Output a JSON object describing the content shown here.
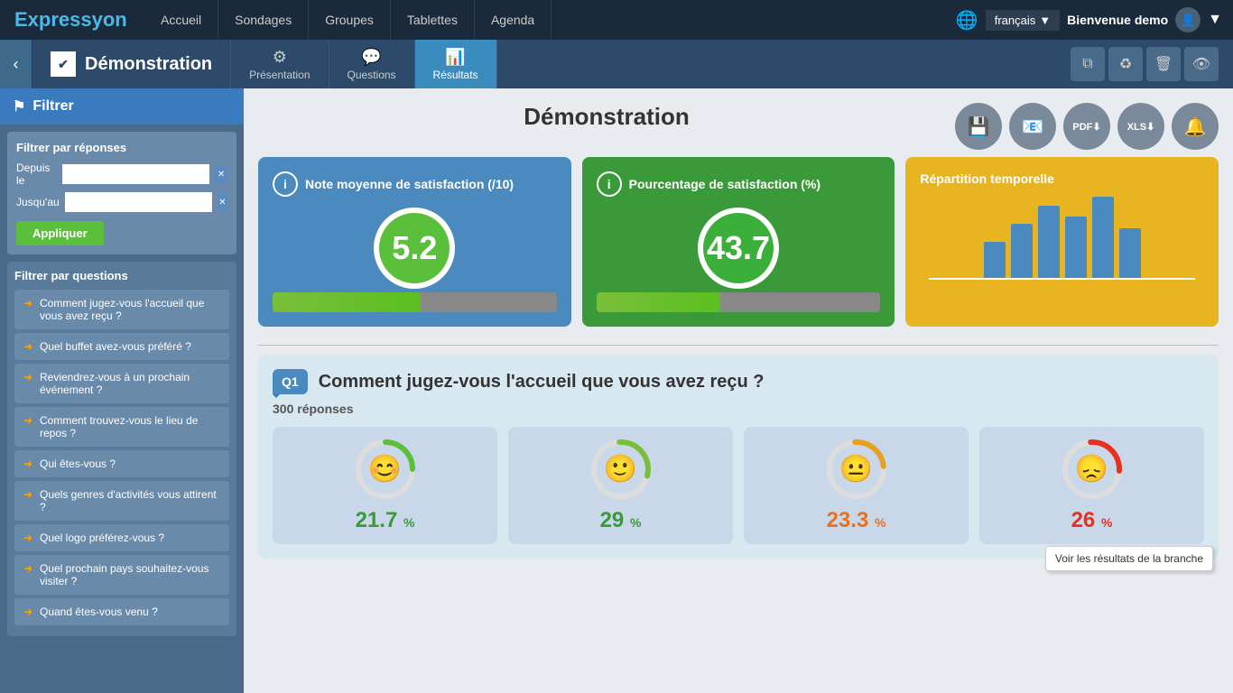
{
  "app": {
    "logo": "Expressyon",
    "nav": {
      "items": [
        {
          "label": "Accueil"
        },
        {
          "label": "Sondages"
        },
        {
          "label": "Groupes"
        },
        {
          "label": "Tablettes"
        },
        {
          "label": "Agenda"
        }
      ]
    },
    "language": "français",
    "welcome": "Bienvenue demo"
  },
  "survey_bar": {
    "back_label": "‹",
    "survey_icon": "✔",
    "survey_title": "Démonstration",
    "tabs": [
      {
        "id": "presentation",
        "icon": "⚙",
        "label": "Présentation"
      },
      {
        "id": "questions",
        "icon": "💬",
        "label": "Questions"
      },
      {
        "id": "resultats",
        "icon": "📊",
        "label": "Résultats",
        "active": true
      }
    ],
    "actions": [
      {
        "icon": "⧉",
        "label": "copy"
      },
      {
        "icon": "♻",
        "label": "recycle"
      },
      {
        "icon": "🗑",
        "label": "delete"
      },
      {
        "icon": "👁",
        "label": "preview"
      }
    ]
  },
  "sidebar": {
    "header": "Filtrer",
    "filter_by_responses": "Filtrer par réponses",
    "depuis_label": "Depuis le",
    "jusquau_label": "Jusqu'au",
    "apply_label": "Appliquer",
    "filter_by_questions": "Filtrer par questions",
    "questions": [
      {
        "text": "Comment jugez-vous l'accueil que vous avez reçu ?"
      },
      {
        "text": "Quel buffet avez-vous préféré ?"
      },
      {
        "text": "Reviendrez-vous à un prochain événement ?"
      },
      {
        "text": "Comment trouvez-vous le lieu de repos ?"
      },
      {
        "text": "Qui êtes-vous ?"
      },
      {
        "text": "Quels genres d'activités vous attirent ?"
      },
      {
        "text": "Quel logo préférez-vous ?"
      },
      {
        "text": "Quel prochain pays souhaitez-vous visiter ?"
      },
      {
        "text": "Quand êtes-vous venu ?"
      }
    ]
  },
  "results": {
    "title": "Démonstration",
    "toolbar": {
      "save": "💾",
      "email": "📧",
      "pdf": "PDF",
      "xls": "XLS",
      "alert": "🔔"
    },
    "stat_cards": {
      "satisfaction_avg": {
        "title": "Note moyenne de satisfaction (/10)",
        "value": "5.2",
        "progress": 52
      },
      "satisfaction_pct": {
        "title": "Pourcentage de satisfaction (%)",
        "value": "43.7",
        "progress": 43.7
      },
      "temporal": {
        "title": "Répartition temporelle",
        "bars": [
          40,
          60,
          80,
          70,
          90,
          55
        ]
      }
    },
    "question1": {
      "badge": "Q1",
      "text": "Comment jugez-vous l'accueil que vous avez reçu ?",
      "responses": "300 réponses",
      "smileys": [
        {
          "pct": "21.7",
          "color": "green",
          "face": "very-happy",
          "emoji": "😊"
        },
        {
          "pct": "29",
          "color": "green",
          "face": "happy",
          "emoji": "🙂"
        },
        {
          "pct": "23.3",
          "color": "orange",
          "face": "neutral",
          "emoji": "😐"
        },
        {
          "pct": "26",
          "color": "red",
          "face": "unhappy",
          "emoji": "😞"
        }
      ],
      "tooltip": "Voir les résultats de la branche"
    }
  }
}
